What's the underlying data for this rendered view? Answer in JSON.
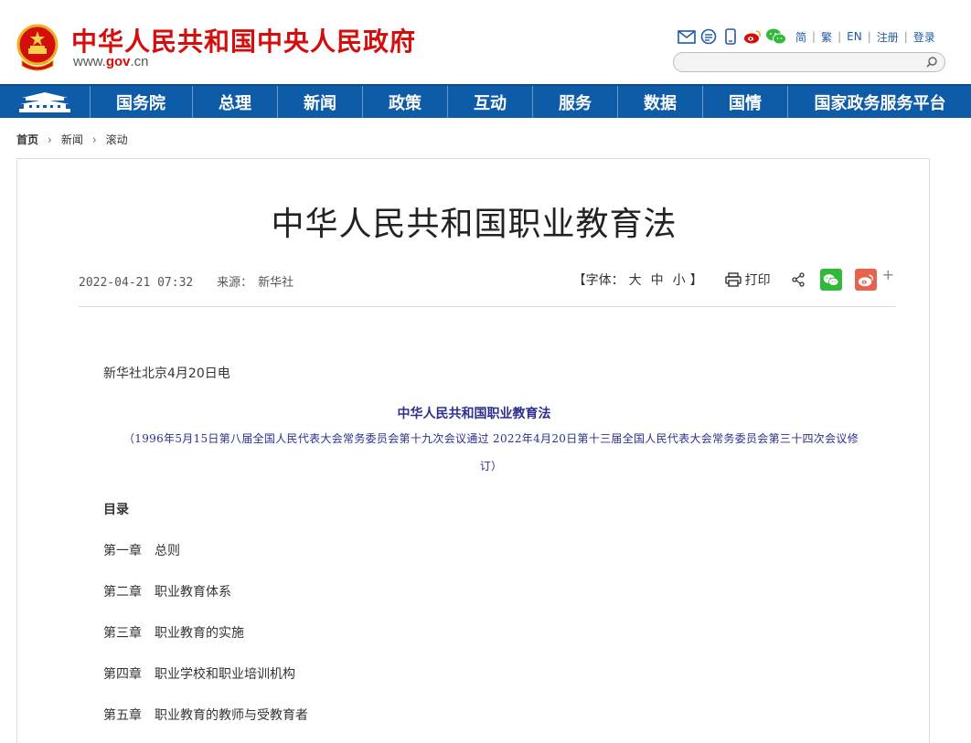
{
  "header": {
    "site_title": "中华人民共和国中央人民政府",
    "site_url_prefix": "www.",
    "site_url_gov": "gov",
    "site_url_suffix": ".cn",
    "lang_links": [
      "简",
      "繁",
      "EN",
      "注册",
      "登录"
    ],
    "search_placeholder": ""
  },
  "nav": {
    "items": [
      "国务院",
      "总理",
      "新闻",
      "政策",
      "互动",
      "服务",
      "数据",
      "国情",
      "国家政务服务平台"
    ]
  },
  "breadcrumb": [
    "首页",
    "新闻",
    "滚动"
  ],
  "article": {
    "title": "中华人民共和国职业教育法",
    "date": "2022-04-21 07:32",
    "source_label": "来源：",
    "source": "新华社",
    "font_label_open": "【字体：",
    "font_sizes": [
      "大",
      "中",
      "小"
    ],
    "font_label_close": "】",
    "print_label": "打印",
    "plus": "+",
    "dateline": "新华社北京4月20日电",
    "law_title": "中华人民共和国职业教育法",
    "law_subtitle_line1": "（1996年5月15日第八届全国人民代表大会常务委员会第十九次会议通过 2022年4月20日第十三届全国人民代表大会常务委员会第三十四次会议修",
    "law_subtitle_line2": "订）",
    "toc_heading": "目录",
    "chapters": [
      {
        "num": "第一章",
        "name": "总则"
      },
      {
        "num": "第二章",
        "name": "职业教育体系"
      },
      {
        "num": "第三章",
        "name": "职业教育的实施"
      },
      {
        "num": "第四章",
        "name": "职业学校和职业培训机构"
      },
      {
        "num": "第五章",
        "name": "职业教育的教师与受教育者"
      }
    ]
  },
  "colors": {
    "brand_red": "#d40d0d",
    "nav_blue": "#0e5ba8",
    "law_text": "#2c2f8f",
    "wechat_green": "#30b93a",
    "weibo_orange": "#e8634e"
  }
}
